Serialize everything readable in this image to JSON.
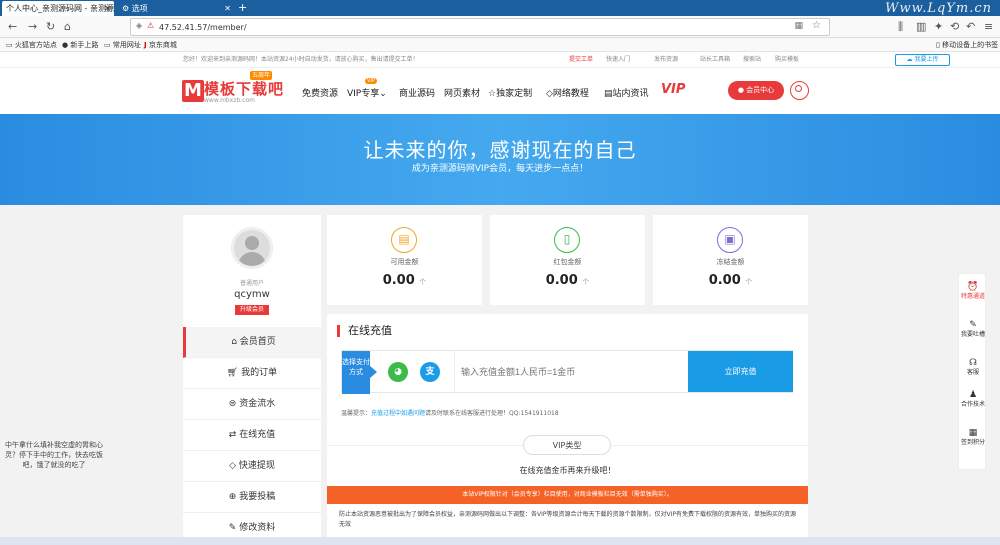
{
  "browser": {
    "tab1": "个人中心_亲测源码网 - 亲测源码网",
    "tab2": "选项",
    "url": "47.52.41.57/member/",
    "watermark": "Www.LqYm.cn",
    "mobile_bookmarks": "移动设备上的书签"
  },
  "bookmarks": [
    "火狐官方站点",
    "新手上路",
    "常用网址",
    "京东商城"
  ],
  "topstrip": {
    "welcome": "您好！欢迎来到亲测源码网！本站资源24小时自动发货，请放心购买，售出请提交工单！",
    "links": [
      "提交工单",
      "快速入门",
      "发布资源",
      "站长工具箱",
      "搜索站",
      "购买模板"
    ],
    "upload": "我要上传"
  },
  "header": {
    "logo_letter": "M",
    "logo_text": "模板下载吧",
    "logo_sub": "www.mbxzb.com",
    "logo_badge": "五周年",
    "nav": [
      "免费资源",
      "VIP专享",
      "商业源码",
      "网页素材",
      "独家定制",
      "网络教程",
      "站内资讯"
    ],
    "vip_badge": "VIP",
    "member_button": "会员中心"
  },
  "banner": {
    "title": "让未来的你，感谢现在的自己",
    "subtitle": "成为亲测源码网VIP会员，每天进步一点点！"
  },
  "user": {
    "type": "普通用户",
    "name": "qcymw",
    "upgrade": "升级会员"
  },
  "menu": [
    "会员首页",
    "我的订单",
    "资金流水",
    "在线充值",
    "快速提现",
    "我要投稿",
    "修改资料"
  ],
  "stats": [
    {
      "label": "可用金额",
      "value": "0.00",
      "unit": "个",
      "color": "#f5a623",
      "icon": "coins-icon"
    },
    {
      "label": "红包金额",
      "value": "0.00",
      "unit": "个",
      "color": "#3bbb4a",
      "icon": "redpacket-icon"
    },
    {
      "label": "冻结金额",
      "value": "0.00",
      "unit": "个",
      "color": "#7b6fd6",
      "icon": "freeze-icon"
    }
  ],
  "recharge": {
    "title": "在线充值",
    "pay_label": "选择支付方式",
    "placeholder": "输入充值金额1人民币=1金币",
    "button": "立即充值",
    "tip_prefix": "温馨提示：",
    "tip_link": "充值过程中如遇问题",
    "tip_suffix": "请及时联系在线客服进行处理！QQ:1541911018"
  },
  "vip": {
    "pill": "VIP类型",
    "hint": "在线充值金币再来升级吧！",
    "bar": "本站VIP权限针对（会员专享）栏目使用，对商业模板栏目无效（需单独购买）。",
    "desc": "防止本站资源恶意被批出为了保障会员权益，亲测源码网做出以下调整：各VIP等级资源合计每天下载的资源个数限制，仅对VIP有免费下载权限的资源有效，单独购买的资源无效"
  },
  "rightbar": [
    {
      "label": "特惠通道",
      "icon": "gift-icon"
    },
    {
      "label": "我要吐槽",
      "icon": "comment-icon"
    },
    {
      "label": "客服",
      "icon": "support-icon"
    },
    {
      "label": "合作技术",
      "icon": "team-icon"
    },
    {
      "label": "签到积分",
      "icon": "calendar-icon"
    }
  ],
  "leftfloat": "中午拿什么填补我空虚的胃和心灵？停下手中的工作，快去吃饭吧，饿了就没的吃了"
}
